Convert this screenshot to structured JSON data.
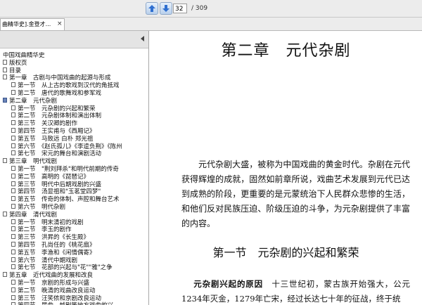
{
  "toolbar": {
    "page_current": "32",
    "page_total": "/ 309",
    "prev_icon": "arrow-up-icon",
    "next_icon": "arrow-down-icon"
  },
  "tab": {
    "label": "曲精华史].金登才...",
    "close": "×"
  },
  "sidebar": {
    "items": [
      {
        "label": "中国戏曲精华史",
        "level": 0,
        "icon": false
      },
      {
        "label": "版权页",
        "level": 0,
        "icon": true
      },
      {
        "label": "目录",
        "level": 0,
        "icon": true
      },
      {
        "label": "第一章　古剧与中国戏曲的起源与形成",
        "level": 0,
        "icon": true
      },
      {
        "label": "第一节　从上古的歌戏到汉代的角抵戏",
        "level": 1,
        "icon": true
      },
      {
        "label": "第二节　唐代的歌舞戏和参军戏",
        "level": 1,
        "icon": true
      },
      {
        "label": "第二章　元代杂剧",
        "level": 0,
        "icon": true,
        "selected": true
      },
      {
        "label": "第一节　元杂剧的兴起和繁荣",
        "level": 1,
        "icon": true
      },
      {
        "label": "第二节　元杂剧体制和演出体制",
        "level": 1,
        "icon": true
      },
      {
        "label": "第三节　关汉卿的剧作",
        "level": 1,
        "icon": true
      },
      {
        "label": "第四节　王实甫与《西厢记》",
        "level": 1,
        "icon": true
      },
      {
        "label": "第五节　马致远 白朴 郑光祖",
        "level": 1,
        "icon": true
      },
      {
        "label": "第六节　《赵氏孤儿》《李逵负荆》《陈州",
        "level": 1,
        "icon": true
      },
      {
        "label": "第七节　宋元的舞台和演剧活动",
        "level": 1,
        "icon": true
      },
      {
        "label": "第三章　明代戏剧",
        "level": 0,
        "icon": true
      },
      {
        "label": "第一节　\"荆刘拜杀\"和明代前期的传奇",
        "level": 1,
        "icon": true
      },
      {
        "label": "第二节　高明的《琵琶记》",
        "level": 1,
        "icon": true
      },
      {
        "label": "第三节　明代中后期戏剧的兴盛",
        "level": 1,
        "icon": true
      },
      {
        "label": "第四节　汤显祖和\"玉茗堂四梦\"",
        "level": 1,
        "icon": true
      },
      {
        "label": "第五节　传奇的体制、声腔和舞台艺术",
        "level": 1,
        "icon": true
      },
      {
        "label": "第六节　明代杂剧",
        "level": 1,
        "icon": true
      },
      {
        "label": "第四章　清代戏剧",
        "level": 0,
        "icon": true
      },
      {
        "label": "第一节　明末清初的戏剧",
        "level": 1,
        "icon": true
      },
      {
        "label": "第二节　李玉的剧作",
        "level": 1,
        "icon": true
      },
      {
        "label": "第三节　洪昇的《长生殿》",
        "level": 1,
        "icon": true
      },
      {
        "label": "第四节　孔尚任的《桃花扇》",
        "level": 1,
        "icon": true
      },
      {
        "label": "第五节　李渔和《闲情偶寄》",
        "level": 1,
        "icon": true
      },
      {
        "label": "第六节　清代中期戏剧",
        "level": 1,
        "icon": true
      },
      {
        "label": "第七节　花部的兴起与\"花\"\"雅\"之争",
        "level": 1,
        "icon": true
      },
      {
        "label": "第五章　近代戏曲的发展和改良",
        "level": 0,
        "icon": true
      },
      {
        "label": "第一节　京剧的形成与兴盛",
        "level": 1,
        "icon": true
      },
      {
        "label": "第二节　晚清的戏曲改良运动",
        "level": 1,
        "icon": true
      },
      {
        "label": "第三节　汪笑侬和京剧改良运动",
        "level": 1,
        "icon": true
      },
      {
        "label": "第四节　昆曲、越剧等地方戏曲的兴",
        "level": 1,
        "icon": true
      }
    ]
  },
  "document": {
    "chapter_title": "第二章　元代杂剧",
    "paragraph": "元代杂剧大盛，被称为中国戏曲的黄金时代。杂剧在元代获得辉煌的成就，固然如前章所说，戏曲艺术发展到元代已达到成熟的阶段，更重要的是元蒙统治下人民群众悲惨的生活，和他们反对民族压迫、阶级压迫的斗争，为元杂剧提供了丰富的内容。",
    "section_title": "第一节　元杂剧的兴起和繁荣",
    "para2_bold": "元杂剧兴起的原因",
    "para2_text": "　十三世纪初，蒙古族开始强大，公元1234年灭金，1279年亡宋，经过长达七十年的征战，终于统"
  }
}
